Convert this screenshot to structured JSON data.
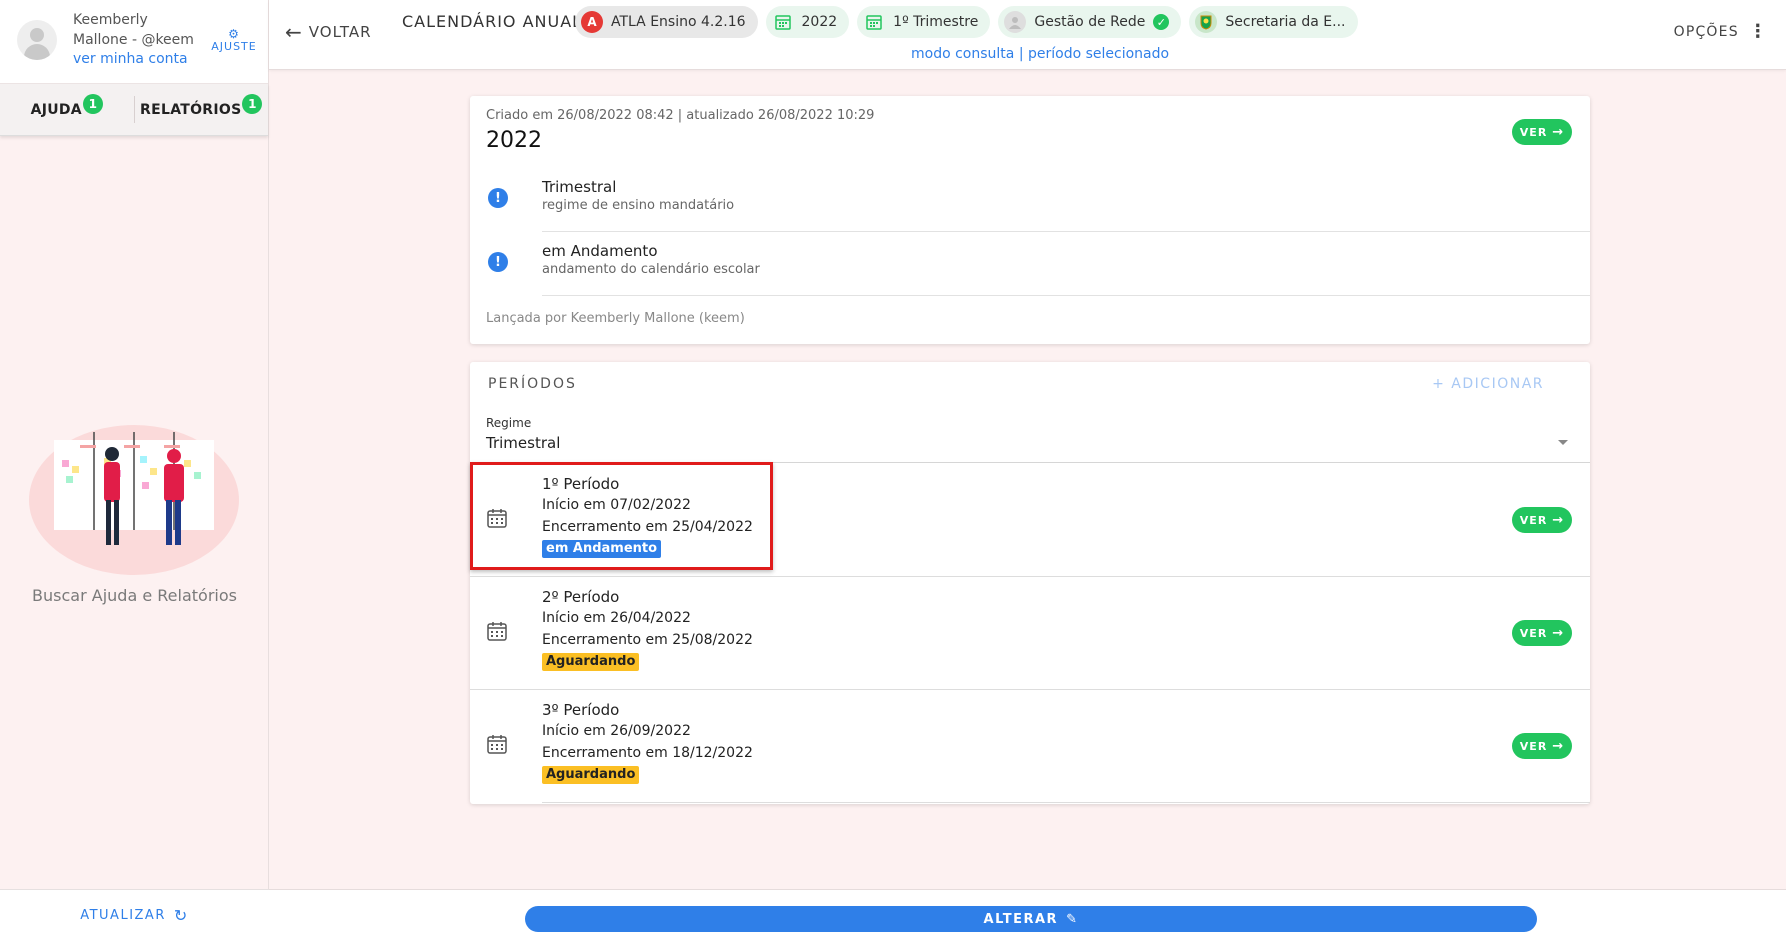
{
  "sidebar": {
    "user_name": "Keemberly Mallone - @keem",
    "account_link": "ver minha conta",
    "ajuste_label": "AJUSTE",
    "tabs": [
      {
        "label": "AJUDA",
        "badge": "1"
      },
      {
        "label": "RELATÓRIOS",
        "badge": "1"
      }
    ],
    "help_caption": "Buscar Ajuda e Relatórios",
    "refresh_label": "ATUALIZAR"
  },
  "topbar": {
    "back_label": "VOLTAR",
    "title": "CALENDÁRIO ANUAL",
    "chips": [
      {
        "label": "ATLA Ensino 4.2.16",
        "icon": "atla-logo-icon"
      },
      {
        "label": "2022",
        "icon": "calendar-icon"
      },
      {
        "label": "1º Trimestre",
        "icon": "calendar-icon"
      },
      {
        "label": "Gestão de Rede",
        "icon": "person-icon"
      },
      {
        "label": "Secretaria da E...",
        "icon": "seal-icon"
      }
    ],
    "mode_text": "modo consulta | período selecionado",
    "options_label": "OPÇÕES"
  },
  "calendar": {
    "meta": "Criado em 26/08/2022 08:42 | atualizado 26/08/2022 10:29",
    "year": "2022",
    "ver_label": "VER",
    "info": [
      {
        "title": "Trimestral",
        "subtitle": "regime de ensino mandatário"
      },
      {
        "title": "em Andamento",
        "subtitle": "andamento do calendário escolar"
      }
    ],
    "launched_by": "Lançada por Keemberly Mallone (keem)"
  },
  "periods": {
    "title": "PERÍODOS",
    "add_label": "+ ADICIONAR",
    "regime_label": "Regime",
    "regime_value": "Trimestral",
    "ver_label": "VER",
    "items": [
      {
        "name": "1º Período",
        "start": "Início em 07/02/2022",
        "end": "Encerramento em 25/04/2022",
        "status": "em Andamento"
      },
      {
        "name": "2º Período",
        "start": "Início em 26/04/2022",
        "end": "Encerramento em 25/08/2022",
        "status": "Aguardando"
      },
      {
        "name": "3º Período",
        "start": "Início em 26/09/2022",
        "end": "Encerramento em 18/12/2022",
        "status": "Aguardando"
      }
    ]
  },
  "footer": {
    "alterar_label": "ALTERAR"
  },
  "colors": {
    "accent": "#2f7fe8",
    "success": "#22c55e",
    "warning": "#fbbf24",
    "highlight": "#e01b1b",
    "background": "#fdf1f1"
  }
}
